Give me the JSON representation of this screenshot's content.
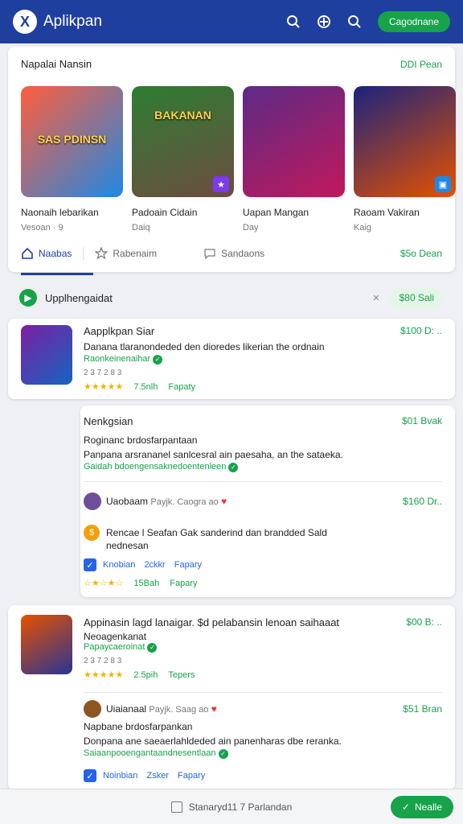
{
  "header": {
    "logo": "X",
    "title": "Aplikpan",
    "button": "Cagodnane"
  },
  "featured": {
    "title": "Napalai Nansin",
    "link": "DDI Pean",
    "tiles": [
      {
        "art": "SAS PDINSN",
        "name": "Naonaih lebarikan",
        "sub": "Vesoan  ·  9",
        "colors": [
          "#ff5e3a",
          "#1e88e5"
        ]
      },
      {
        "art": "BAKANAN",
        "name": "Padoain Cidain",
        "sub": "Daiq",
        "colors": [
          "#2e7d32",
          "#6d4c41"
        ]
      },
      {
        "art": "",
        "name": "Uapan Mangan",
        "sub": "Day",
        "colors": [
          "#5b2a86",
          "#c2185b"
        ]
      },
      {
        "art": "",
        "name": "Raoam Vakiran",
        "sub": "Kaig",
        "colors": [
          "#1a237e",
          "#e65100"
        ]
      }
    ]
  },
  "tabs": {
    "t1": "Naabas",
    "t2": "Rabenaim",
    "t3": "Sandaons",
    "link": "$5o Dean"
  },
  "updates": {
    "title": "Upplhengaidat",
    "button": "$80 Sali"
  },
  "app1": {
    "title": "Aapplkpan Siar",
    "price": "$100 D: ..",
    "desc": "Danana tlaranondeded den dioredes likerian the ordnain",
    "green": "Raonkeinenaihar",
    "small": "2 3 7   2  8 3",
    "rating": "★★★★★",
    "meta1": "7.5nlh",
    "meta2": "Fapaty"
  },
  "app2": {
    "title": "Nenkgsian",
    "price": "$01 Bvak",
    "desc1": "Roginanc brdosfarpantaan",
    "desc2": "Panpana arsrananel sanlcesral ain paesaha, an the sataeka.",
    "green": "Gaidah bdoengensaknedoentenleen",
    "user": "Uaobaam",
    "user_meta": "Payjk. Caogra ao",
    "user_price": "$160 Dr..",
    "coin_text": "Rencae l Seafan Gak sanderind  dan brandded Sald nednesan",
    "chk1": "Knobian",
    "chk2": "2ckkr",
    "chk3": "Fapary",
    "rating": "☆★☆★☆",
    "meta1": "15Bah",
    "meta2": "Fapary"
  },
  "app3": {
    "title": "Appinasin lagd lanaigar. $d pelabansin lenoan saihaaat",
    "title2": "Neoagenkanat",
    "price": "$00 B: ..",
    "green": "Papaycaeroinat",
    "small": "2 3 7   2  8 3",
    "rating": "★★★★★",
    "meta1": "2.5pih",
    "meta2": "Tepers",
    "user": "Uiaianaal",
    "user_meta": "Payjk. Saag ao",
    "user_price": "$51 Bran",
    "desc1": "Napbane brdosfarpankan",
    "desc2": "Donpana ane saeaerlahldeded ain panenharas dbe reranka.",
    "green2": "Saiaanpooengantaandnesentlaan",
    "chk1": "Noinbian",
    "chk2": "Zsker",
    "chk3": "Fapary"
  },
  "bottom": {
    "text": "Stanaryd11 7 Parlandan",
    "button": "Nealle"
  }
}
